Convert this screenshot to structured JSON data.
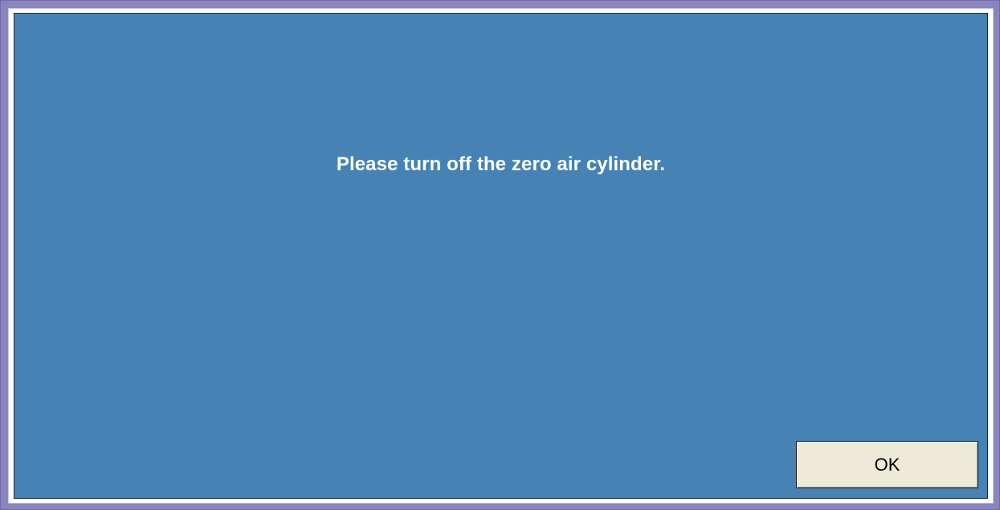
{
  "dialog": {
    "message": "Please turn off the zero air cylinder.",
    "ok_label": "OK"
  },
  "colors": {
    "frame": "#8a86bd",
    "body_background": "#4682b4",
    "message_text": "#ffffff",
    "button_face": "#ece9d8"
  }
}
